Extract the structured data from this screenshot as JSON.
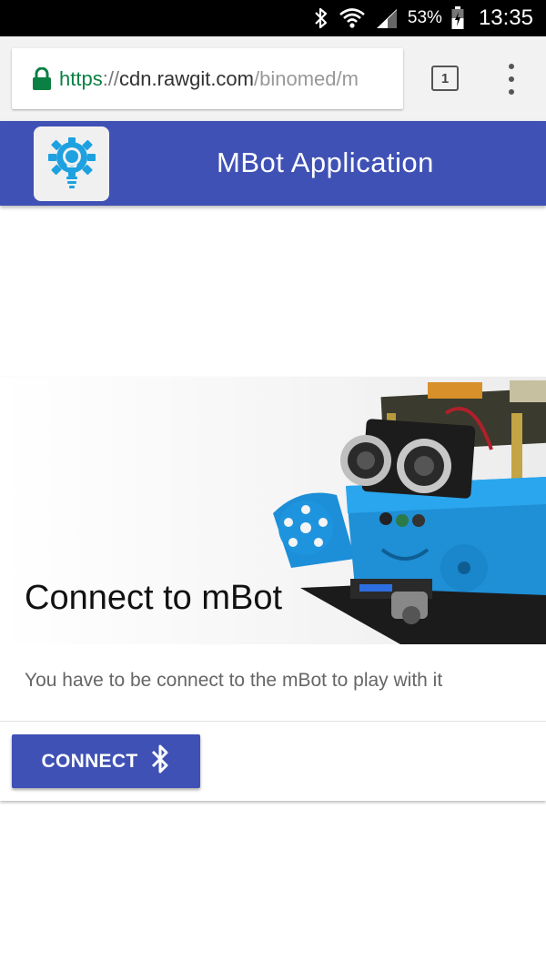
{
  "status_bar": {
    "battery_percent": "53%",
    "time": "13:35",
    "icons": [
      "bluetooth-icon",
      "wifi-icon",
      "signal-icon",
      "battery-icon"
    ]
  },
  "browser": {
    "url": {
      "scheme": "https",
      "separator": "://",
      "host": "cdn.rawgit.com",
      "path": "/binomed/m"
    },
    "tab_count": "1"
  },
  "app": {
    "title": "MBot Application",
    "primary_color": "#3f51b5"
  },
  "card": {
    "title": "Connect to mBot",
    "text": "You have to be connect to the mBot to play with it",
    "button_label": "CONNECT"
  }
}
